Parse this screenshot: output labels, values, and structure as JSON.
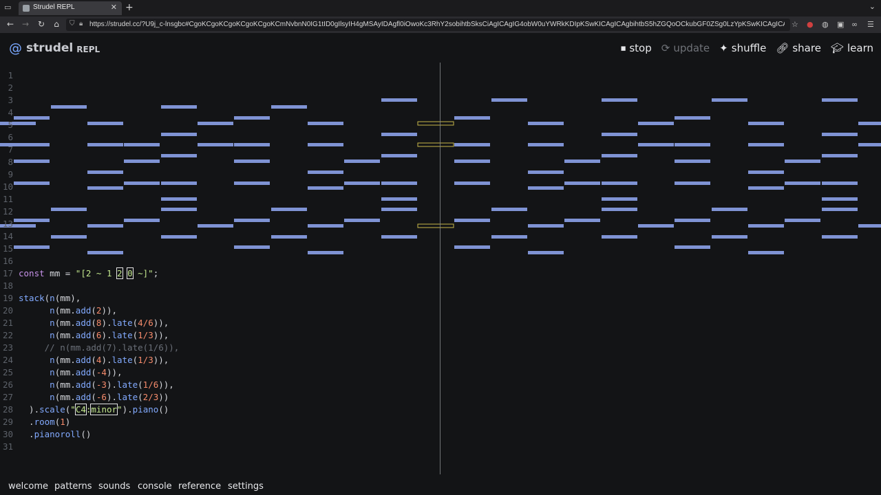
{
  "browser": {
    "tab_title": "Strudel REPL",
    "url": "https://strudel.cc/?U9j_c-lnsgbc#CgoKCgoKCgoKCgoKCgoKCmNvbnN0IG1tID0gIlsyIH4gMSAyIDAgfl0iOwoKc3RhY2sobihtbSksCiAgICAgIG4obW0uYWRkKDIpKSwKICAgICAgbihtbS5hZGQoOCkubGF0ZSg0LzYpKSwKICAgICAgbihtbS5hZGQoNikubGF0ZSgxLzMpKSwKICAgICAgbihtbS5hZGQoNikubGF0"
  },
  "app": {
    "logo_name": "strudel",
    "logo_sub": "REPL",
    "actions": {
      "stop": "stop",
      "update": "update",
      "shuffle": "shuffle",
      "share": "share",
      "learn": "learn"
    }
  },
  "editor": {
    "line_numbers": [
      "1",
      "2",
      "3",
      "4",
      "5",
      "6",
      "7",
      "8",
      "9",
      "10",
      "11",
      "12",
      "13",
      "14",
      "15",
      "16",
      "17",
      "18",
      "19",
      "20",
      "21",
      "22",
      "23",
      "24",
      "25",
      "26",
      "27",
      "28",
      "29",
      "30",
      "31"
    ]
  },
  "panel": {
    "tabs": [
      "welcome",
      "patterns",
      "sounds",
      "console",
      "reference",
      "settings"
    ]
  },
  "colors": {
    "note_bar": "#7f93d4",
    "note_outline": "#c8b84a",
    "accent": "#7aa8ff"
  }
}
